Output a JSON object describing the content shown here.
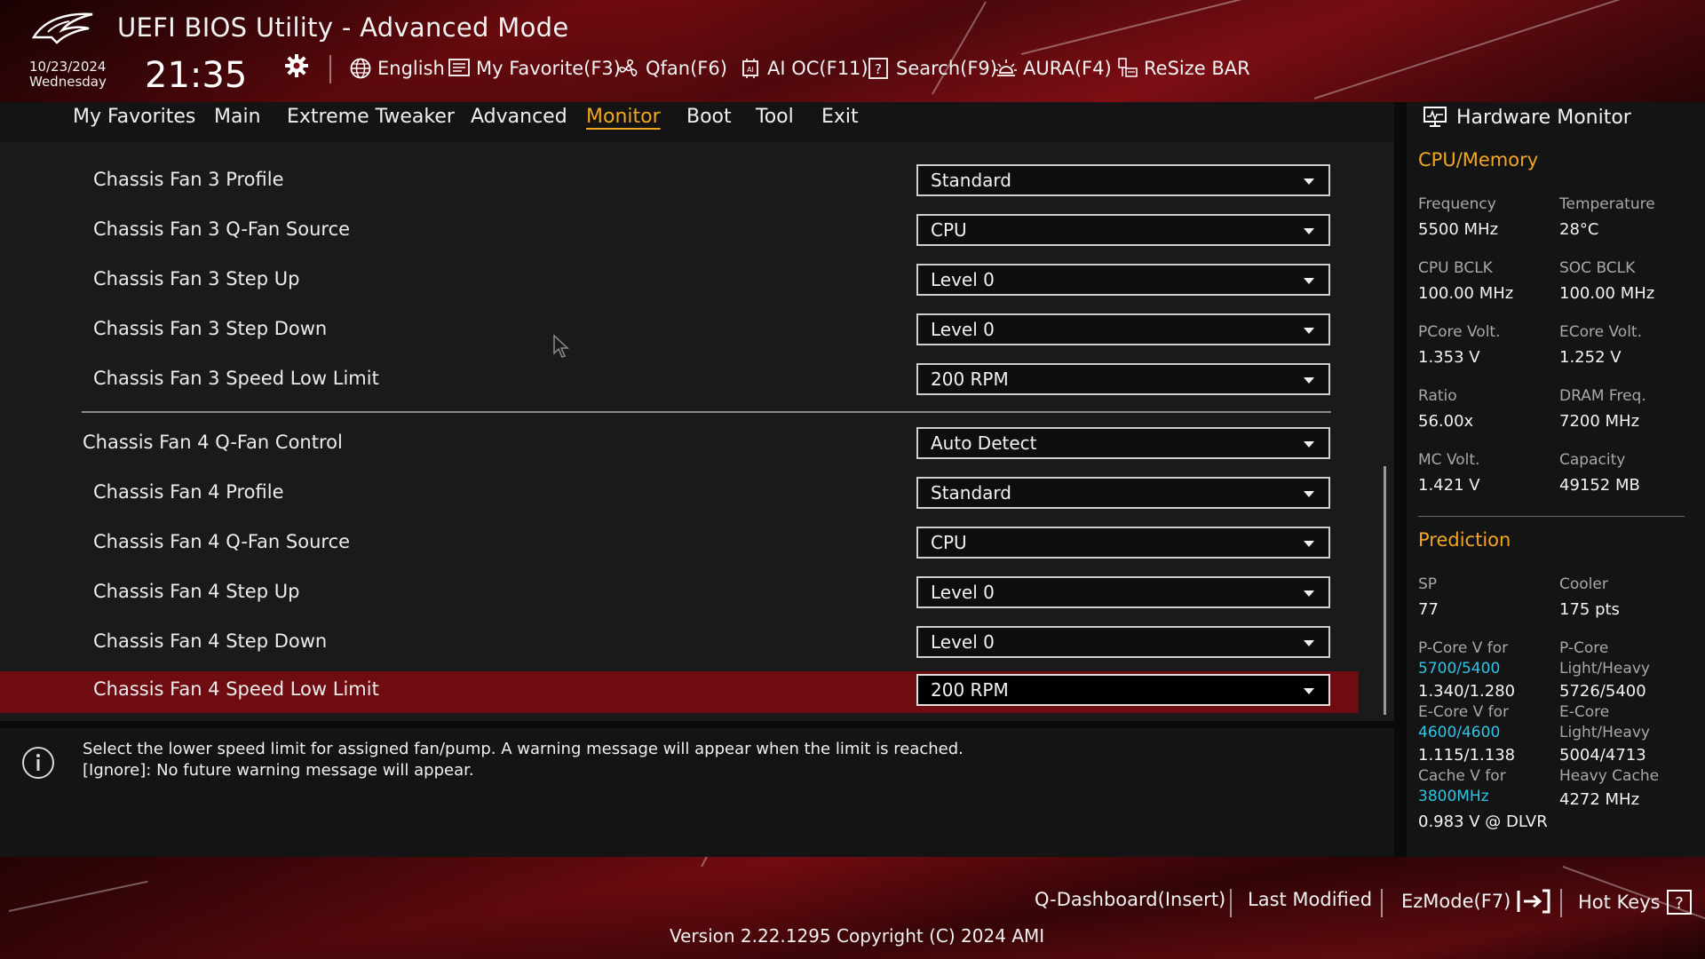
{
  "header": {
    "title": "UEFI BIOS Utility - Advanced Mode",
    "date": "10/23/2024",
    "weekday": "Wednesday",
    "time": "21:35",
    "tools": [
      {
        "label": "English",
        "icon": "globe-icon"
      },
      {
        "label": "My Favorite(F3)",
        "icon": "favorite-list-icon"
      },
      {
        "label": "Qfan(F6)",
        "icon": "fan-icon"
      },
      {
        "label": "AI OC(F11)",
        "icon": "ai-chip-icon"
      },
      {
        "label": "Search(F9)",
        "icon": "search-help-icon"
      },
      {
        "label": "AURA(F4)",
        "icon": "aura-light-icon"
      },
      {
        "label": "ReSize BAR",
        "icon": "resize-bar-icon"
      }
    ]
  },
  "tabs": [
    {
      "label": "My Favorites",
      "active": false
    },
    {
      "label": "Main",
      "active": false
    },
    {
      "label": "Extreme Tweaker",
      "active": false
    },
    {
      "label": "Advanced",
      "active": false
    },
    {
      "label": "Monitor",
      "active": true
    },
    {
      "label": "Boot",
      "active": false
    },
    {
      "label": "Tool",
      "active": false
    },
    {
      "label": "Exit",
      "active": false
    }
  ],
  "settings": [
    {
      "label": "Chassis Fan 3 Profile",
      "value": "Standard"
    },
    {
      "label": "Chassis Fan 3 Q-Fan Source",
      "value": "CPU"
    },
    {
      "label": "Chassis Fan 3 Step Up",
      "value": "Level 0"
    },
    {
      "label": "Chassis Fan 3 Step Down",
      "value": "Level 0"
    },
    {
      "label": "Chassis Fan 3 Speed Low Limit",
      "value": "200 RPM"
    },
    {
      "label": "Chassis Fan 4 Q-Fan Control",
      "value": "Auto Detect"
    },
    {
      "label": "Chassis Fan 4 Profile",
      "value": "Standard"
    },
    {
      "label": "Chassis Fan 4 Q-Fan Source",
      "value": "CPU"
    },
    {
      "label": "Chassis Fan 4 Step Up",
      "value": "Level 0"
    },
    {
      "label": "Chassis Fan 4 Step Down",
      "value": "Level 0"
    },
    {
      "label": "Chassis Fan 4 Speed Low Limit",
      "value": "200 RPM",
      "selected": true
    }
  ],
  "help": {
    "line1": "Select the lower speed limit for assigned fan/pump. A warning message will appear when the limit is reached.",
    "line2": "[Ignore]: No future warning message will appear."
  },
  "hardware_monitor": {
    "title": "Hardware Monitor",
    "cpu_memory": {
      "heading": "CPU/Memory",
      "items": [
        {
          "label": "Frequency",
          "value": "5500 MHz"
        },
        {
          "label": "Temperature",
          "value": "28°C"
        },
        {
          "label": "CPU BCLK",
          "value": "100.00 MHz"
        },
        {
          "label": "SOC BCLK",
          "value": "100.00 MHz"
        },
        {
          "label": "PCore Volt.",
          "value": "1.353 V"
        },
        {
          "label": "ECore Volt.",
          "value": "1.252 V"
        },
        {
          "label": "Ratio",
          "value": "56.00x"
        },
        {
          "label": "DRAM Freq.",
          "value": "7200 MHz"
        },
        {
          "label": "MC Volt.",
          "value": "1.421 V"
        },
        {
          "label": "Capacity",
          "value": "49152 MB"
        }
      ]
    },
    "prediction": {
      "heading": "Prediction",
      "sp_label": "SP",
      "sp_value": "77",
      "cooler_label": "Cooler",
      "cooler_value": "175 pts",
      "pcore_v_label": "P-Core V for",
      "pcore_v_freq": "5700/5400",
      "pcore_v_value": "1.340/1.280",
      "pcore_lh_label1": "P-Core",
      "pcore_lh_label2": "Light/Heavy",
      "pcore_lh_value": "5726/5400",
      "ecore_v_label": "E-Core V for",
      "ecore_v_freq": "4600/4600",
      "ecore_v_value": "1.115/1.138",
      "ecore_lh_label1": "E-Core",
      "ecore_lh_label2": "Light/Heavy",
      "ecore_lh_value": "5004/4713",
      "cache_v_label": "Cache V for",
      "cache_v_freq": "3800MHz",
      "cache_v_value": "0.983 V @ DLVR",
      "heavy_cache_label": "Heavy Cache",
      "heavy_cache_value": "4272 MHz"
    }
  },
  "footer": {
    "qdashboard": "Q-Dashboard(Insert)",
    "last_modified": "Last Modified",
    "ezmode": "EzMode(F7)",
    "hotkeys": "Hot Keys",
    "version": "Version 2.22.1295 Copyright (C) 2024 AMI"
  },
  "colors": {
    "accent": "#f3a61f",
    "selected_row": "#6e0c11",
    "cyan": "#2ec4e8"
  }
}
